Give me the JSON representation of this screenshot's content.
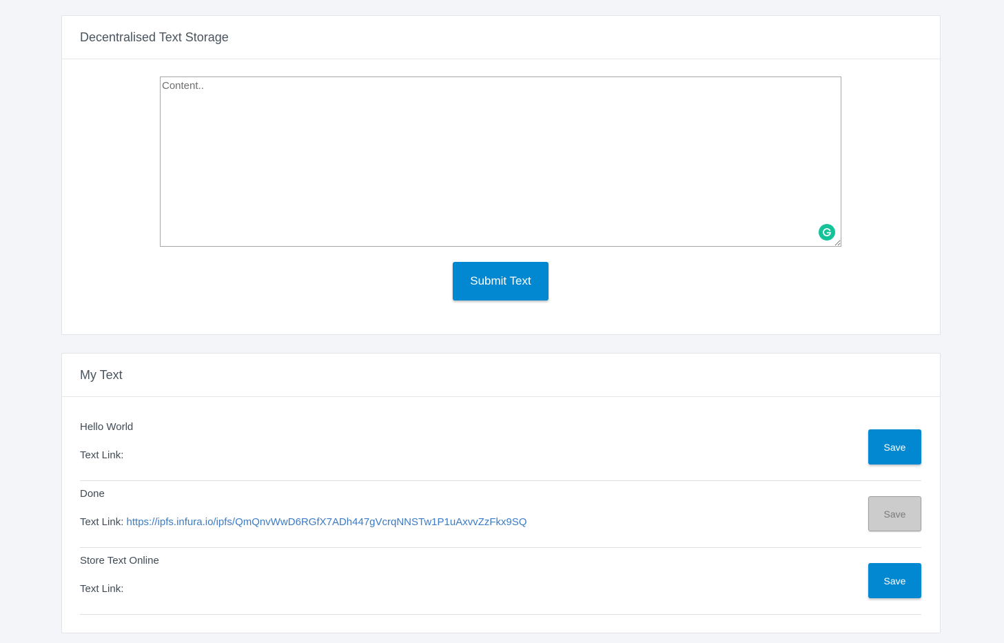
{
  "storage_card": {
    "title": "Decentralised Text Storage",
    "content_placeholder": "Content..",
    "submit_label": "Submit Text"
  },
  "mytext_card": {
    "title": "My Text",
    "link_label": "Text Link:",
    "items": [
      {
        "text": "Hello World",
        "link": "",
        "save_label": "Save",
        "save_state": "enabled"
      },
      {
        "text": "Done",
        "link": "https://ipfs.infura.io/ipfs/QmQnvWwD6RGfX7ADh447gVcrqNNSTw1P1uAxvvZzFkx9SQ",
        "save_label": "Save",
        "save_state": "disabled"
      },
      {
        "text": "Store Text Online",
        "link": "",
        "save_label": "Save",
        "save_state": "enabled"
      }
    ]
  },
  "icons": {
    "grammarly": "grammarly-icon"
  },
  "colors": {
    "primary": "#0288d1",
    "link": "#3a7bc8",
    "grammarly": "#15c39a",
    "disabled_button": "#cccccc"
  }
}
